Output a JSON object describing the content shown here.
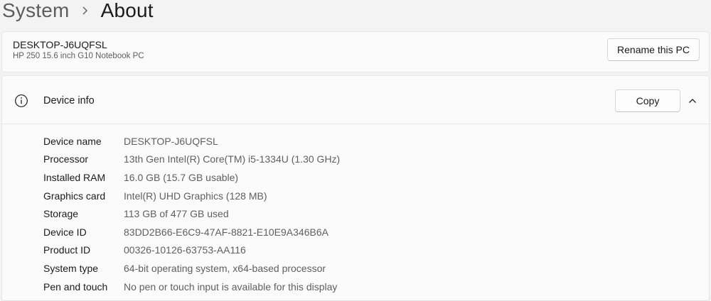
{
  "breadcrumb": {
    "parent": "System",
    "current": "About"
  },
  "pc": {
    "name": "DESKTOP-J6UQFSL",
    "model": "HP 250 15.6 inch G10 Notebook PC",
    "rename_label": "Rename this PC"
  },
  "device_info": {
    "title": "Device info",
    "copy_label": "Copy",
    "specs": [
      {
        "label": "Device name",
        "value": "DESKTOP-J6UQFSL"
      },
      {
        "label": "Processor",
        "value": "13th Gen Intel(R) Core(TM) i5-1334U (1.30 GHz)"
      },
      {
        "label": "Installed RAM",
        "value": "16.0 GB (15.7 GB usable)"
      },
      {
        "label": "Graphics card",
        "value": "Intel(R) UHD Graphics (128 MB)"
      },
      {
        "label": "Storage",
        "value": "113 GB of 477 GB used"
      },
      {
        "label": "Device ID",
        "value": "83DD2B66-E6C9-47AF-8821-E10E9A346B6A"
      },
      {
        "label": "Product ID",
        "value": "00326-10126-63753-AA116"
      },
      {
        "label": "System type",
        "value": "64-bit operating system, x64-based processor"
      },
      {
        "label": "Pen and touch",
        "value": "No pen or touch input is available for this display"
      }
    ]
  },
  "icons": {
    "separator": "chevron-right-icon",
    "info": "info-icon",
    "collapse": "chevron-up-icon"
  }
}
